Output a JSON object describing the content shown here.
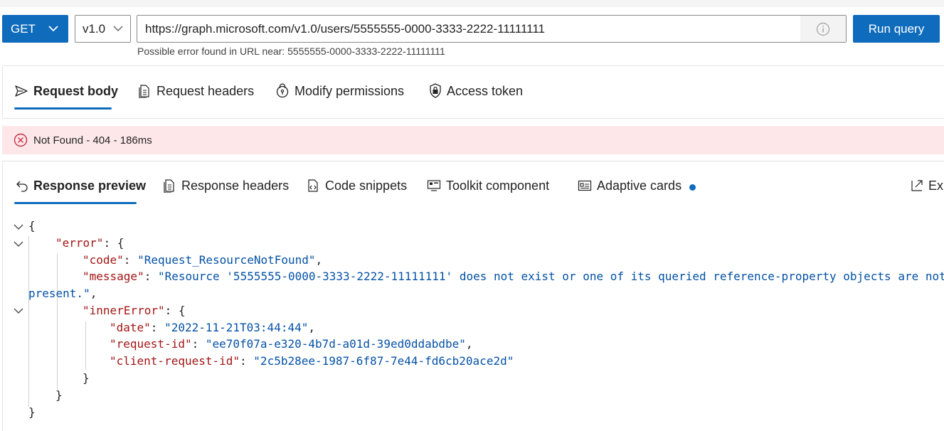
{
  "query": {
    "method": "GET",
    "version": "v1.0",
    "url": "https://graph.microsoft.com/v1.0/users/5555555-0000-3333-2222-11111111",
    "run_label": "Run query",
    "hint": "Possible error found in URL near: 5555555-0000-3333-2222-11111111"
  },
  "request_tabs": [
    {
      "label": "Request body",
      "icon": "send-icon",
      "active": true
    },
    {
      "label": "Request headers",
      "icon": "document-icon",
      "active": false
    },
    {
      "label": "Modify permissions",
      "icon": "lock-key-icon",
      "active": false
    },
    {
      "label": "Access token",
      "icon": "shield-lock-icon",
      "active": false
    }
  ],
  "status": {
    "text": "Not Found - 404 - 186ms",
    "icon": "error-circle-icon",
    "color": "#c4314b",
    "background": "#fde7e9"
  },
  "response_tabs": [
    {
      "label": "Response preview",
      "icon": "back-arrow-icon",
      "active": true
    },
    {
      "label": "Response headers",
      "icon": "document-icon",
      "active": false
    },
    {
      "label": "Code snippets",
      "icon": "code-doc-icon",
      "active": false
    },
    {
      "label": "Toolkit component",
      "icon": "component-icon",
      "active": false
    },
    {
      "label": "Adaptive cards",
      "icon": "card-icon",
      "active": false,
      "has_dot": true
    },
    {
      "label": "Exp",
      "icon": "expand-icon",
      "active": false
    }
  ],
  "response_json": {
    "open_brace": "{",
    "error_key": "\"error\"",
    "code_key": "\"code\"",
    "code_value": "\"Request_ResourceNotFound\"",
    "message_key": "\"message\"",
    "message_value_line1": "\"Resource '5555555-0000-3333-2222-11111111' does not exist or one of its queried reference-property objects are not",
    "message_value_line2": "present.\"",
    "inner_error_key": "\"innerError\"",
    "date_key": "\"date\"",
    "date_value": "\"2022-11-21T03:44:44\"",
    "request_id_key": "\"request-id\"",
    "request_id_value": "\"ee70f07a-e320-4b7d-a01d-39ed0ddabdbe\"",
    "client_request_id_key": "\"client-request-id\"",
    "client_request_id_value": "\"2c5b28ee-1987-6f87-7e44-fd6cb20ace2d\"",
    "close_brace": "}"
  },
  "colors": {
    "accent": "#0f6cbd",
    "json_key": "#a31515",
    "json_string": "#0451a5"
  }
}
